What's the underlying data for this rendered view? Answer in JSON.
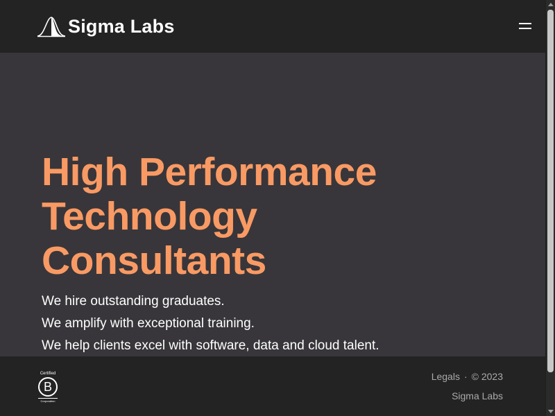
{
  "header": {
    "logo_text": "Sigma Labs",
    "logo_icon": "bell-curve-icon",
    "menu_icon": "hamburger-menu-icon"
  },
  "hero": {
    "title_lines": [
      "High Performance",
      "Technology",
      "Consultants"
    ],
    "lines": [
      "We hire outstanding graduates.",
      "We amplify with exceptional training.",
      "We help clients excel with software, data and cloud talent."
    ]
  },
  "footer": {
    "badge": {
      "top": "Certified",
      "letter": "B",
      "bottom": "Corporation"
    },
    "legals_label": "Legals",
    "separator": "·",
    "copyright": "© 2023",
    "company": "Sigma Labs"
  },
  "colors": {
    "background": "#232323",
    "hero_background": "#38363a",
    "accent": "#f99a64",
    "text": "#ffffff",
    "muted": "#aaaaaa"
  }
}
